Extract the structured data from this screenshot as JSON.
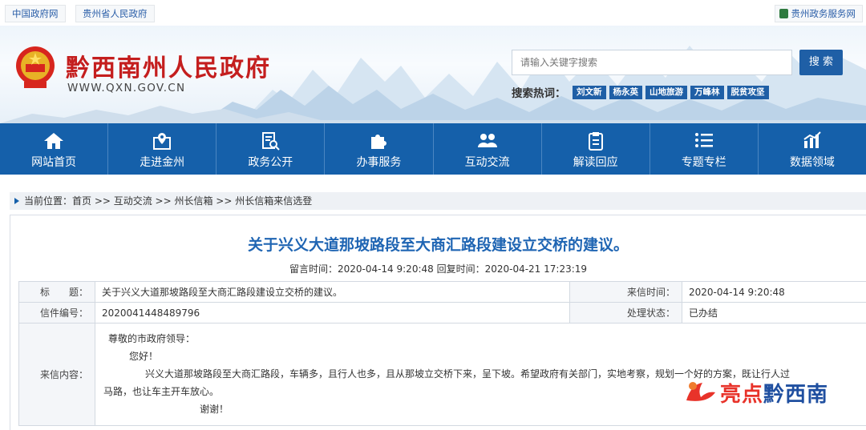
{
  "topbar": {
    "links": [
      "中国政府网",
      "贵州省人民政府"
    ],
    "right_link": "贵州政务服务网"
  },
  "header": {
    "site_title": "黔西南州人民政府",
    "site_url": "WWW.QXN.GOV.CN",
    "search_placeholder": "请输入关键字搜索",
    "search_button": "搜 索",
    "hot_label": "搜索热词：",
    "hot_tags": [
      "刘文新",
      "杨永英",
      "山地旅游",
      "万峰林",
      "脱贫攻坚"
    ]
  },
  "nav": {
    "items": [
      {
        "label": "网站首页",
        "icon": "home-icon"
      },
      {
        "label": "走进金州",
        "icon": "map-pin-icon"
      },
      {
        "label": "政务公开",
        "icon": "document-search-icon"
      },
      {
        "label": "办事服务",
        "icon": "puzzle-icon"
      },
      {
        "label": "互动交流",
        "icon": "people-icon"
      },
      {
        "label": "解读回应",
        "icon": "clipboard-icon"
      },
      {
        "label": "专题专栏",
        "icon": "list-icon"
      },
      {
        "label": "数据领域",
        "icon": "chart-icon"
      }
    ]
  },
  "breadcrumb": {
    "text": "当前位置：首页 >> 互动交流 >> 州长信箱 >> 州长信箱来信选登"
  },
  "article": {
    "title": "关于兴义大道那坡路段至大商汇路段建设立交桥的建议。",
    "meta": "留言时间：2020-04-14 9:20:48 回复时间：2020-04-21 17:23:19",
    "rows": {
      "subject_label": "标　　题：",
      "subject_value": "关于兴义大道那坡路段至大商汇路段建设立交桥的建议。",
      "time_label": "来信时间：",
      "time_value": "2020-04-14 9:20:48",
      "number_label": "信件编号：",
      "number_value": "2020041448489796",
      "status_label": "处理状态：",
      "status_value": "已办结",
      "content_label": "来信内容："
    },
    "letter": {
      "salutation": "尊敬的市政府领导：",
      "greeting": "您好！",
      "body": "兴义大道那坡路段至大商汇路段，车辆多，且行人也多，且从那坡立交桥下来，呈下坡。希望政府有关部门，实地考察，规划一个好的方案，既让行人过马路，也让车主开车放心。",
      "closing": "谢谢！"
    }
  },
  "watermark": {
    "prefix": "亮点",
    "suffix": "黔西南"
  },
  "colors": {
    "nav_bg": "#1560aa",
    "title_blue": "#1f65b3",
    "brand_red": "#c41e1e"
  }
}
